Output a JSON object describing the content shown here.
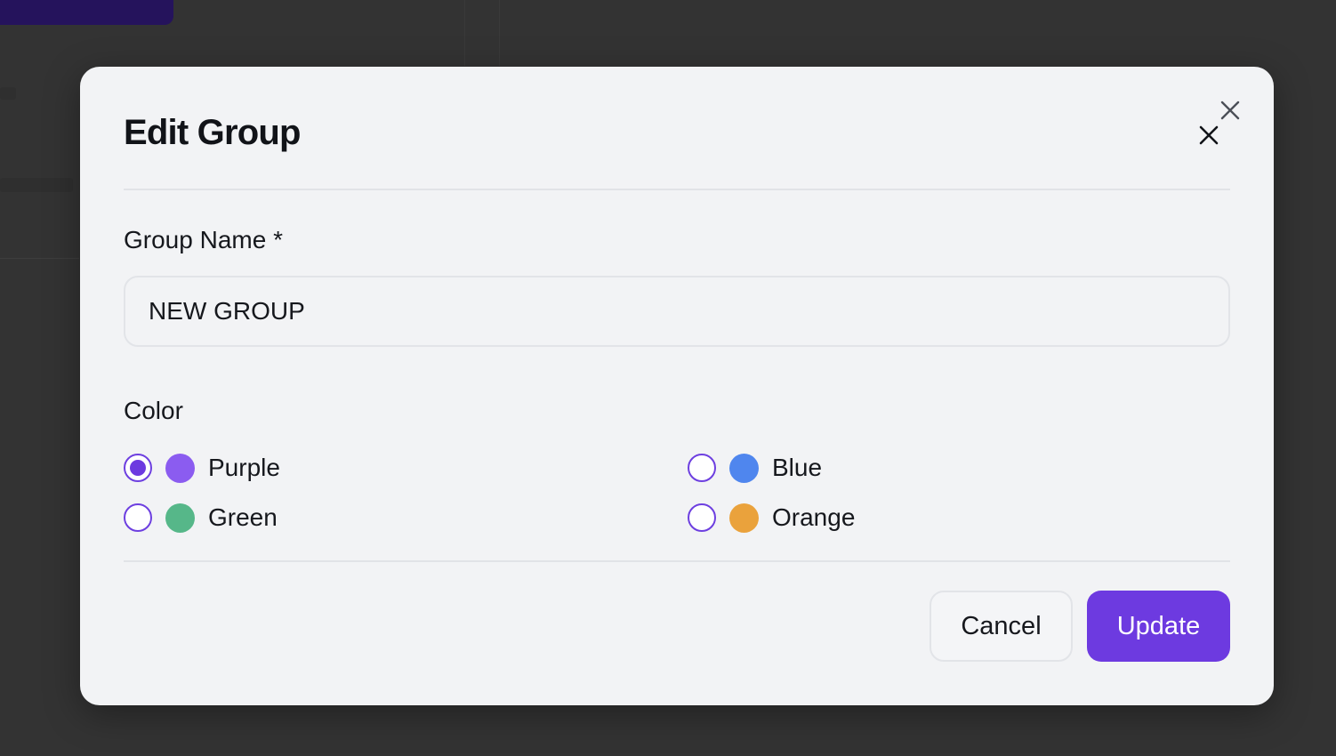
{
  "dialog": {
    "title": "Edit Group",
    "close_icon": "close-icon",
    "group_name": {
      "label": "Group Name *",
      "value": "NEW GROUP"
    },
    "color": {
      "label": "Color",
      "selected": "Purple",
      "options": [
        {
          "label": "Purple",
          "swatch": "#8b5cf0",
          "selected": true
        },
        {
          "label": "Blue",
          "swatch": "#4f86ee",
          "selected": false
        },
        {
          "label": "Green",
          "swatch": "#56b789",
          "selected": false
        },
        {
          "label": "Orange",
          "swatch": "#eaa23c",
          "selected": false
        }
      ]
    },
    "buttons": {
      "cancel": "Cancel",
      "update": "Update"
    }
  },
  "colors": {
    "accent": "#6d3ae0",
    "dialog_background": "#f2f3f5",
    "overlay": "#333333"
  }
}
